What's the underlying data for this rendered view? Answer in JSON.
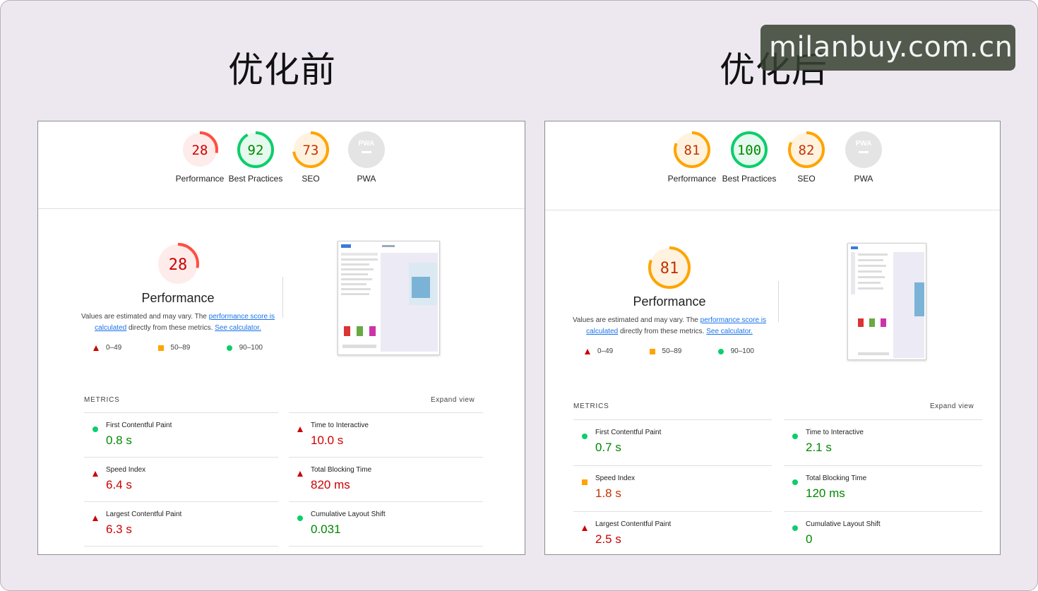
{
  "titles": {
    "before": "优化前",
    "after": "优化后"
  },
  "watermark": "milanbuy.com.cn",
  "colors": {
    "fail": "#ff4e42",
    "average": "#ffa400",
    "pass": "#0cce6b",
    "fail_text": "#cc0000",
    "average_text": "#c33300",
    "pass_text": "#008800",
    "pwa_gray": "#e4e4e4"
  },
  "before": {
    "gauges": [
      {
        "score": "28",
        "label": "Performance",
        "rating": "fail"
      },
      {
        "score": "92",
        "label": "Best Practices",
        "rating": "pass"
      },
      {
        "score": "73",
        "label": "SEO",
        "rating": "average"
      },
      {
        "score": "PWA",
        "label": "PWA",
        "rating": "na"
      }
    ],
    "perf": {
      "score": "28",
      "title": "Performance",
      "desc_prefix": "Values are estimated and may vary. The ",
      "link1": "performance score is calculated",
      "desc_mid": " directly from these metrics. ",
      "link2": "See calculator."
    },
    "legend": {
      "fail": "0–49",
      "average": "50–89",
      "pass": "90–100"
    },
    "metrics_label": "METRICS",
    "expand_label": "Expand view",
    "metrics": [
      {
        "name": "First Contentful Paint",
        "value": "0.8 s",
        "rating": "pass"
      },
      {
        "name": "Time to Interactive",
        "value": "10.0 s",
        "rating": "fail"
      },
      {
        "name": "Speed Index",
        "value": "6.4 s",
        "rating": "fail"
      },
      {
        "name": "Total Blocking Time",
        "value": "820 ms",
        "rating": "fail"
      },
      {
        "name": "Largest Contentful Paint",
        "value": "6.3 s",
        "rating": "fail"
      },
      {
        "name": "Cumulative Layout Shift",
        "value": "0.031",
        "rating": "pass"
      }
    ]
  },
  "after": {
    "gauges": [
      {
        "score": "81",
        "label": "Performance",
        "rating": "average"
      },
      {
        "score": "100",
        "label": "Best Practices",
        "rating": "pass"
      },
      {
        "score": "82",
        "label": "SEO",
        "rating": "average"
      },
      {
        "score": "PWA",
        "label": "PWA",
        "rating": "na"
      }
    ],
    "perf": {
      "score": "81",
      "title": "Performance",
      "desc_prefix": "Values are estimated and may vary. The ",
      "link1": "performance score is calculated",
      "desc_mid": " directly from these metrics. ",
      "link2": "See calculator."
    },
    "legend": {
      "fail": "0–49",
      "average": "50–89",
      "pass": "90–100"
    },
    "metrics_label": "METRICS",
    "expand_label": "Expand view",
    "metrics": [
      {
        "name": "First Contentful Paint",
        "value": "0.7 s",
        "rating": "pass"
      },
      {
        "name": "Time to Interactive",
        "value": "2.1 s",
        "rating": "pass"
      },
      {
        "name": "Speed Index",
        "value": "1.8 s",
        "rating": "average"
      },
      {
        "name": "Total Blocking Time",
        "value": "120 ms",
        "rating": "pass"
      },
      {
        "name": "Largest Contentful Paint",
        "value": "2.5 s",
        "rating": "fail"
      },
      {
        "name": "Cumulative Layout Shift",
        "value": "0",
        "rating": "pass"
      }
    ]
  }
}
